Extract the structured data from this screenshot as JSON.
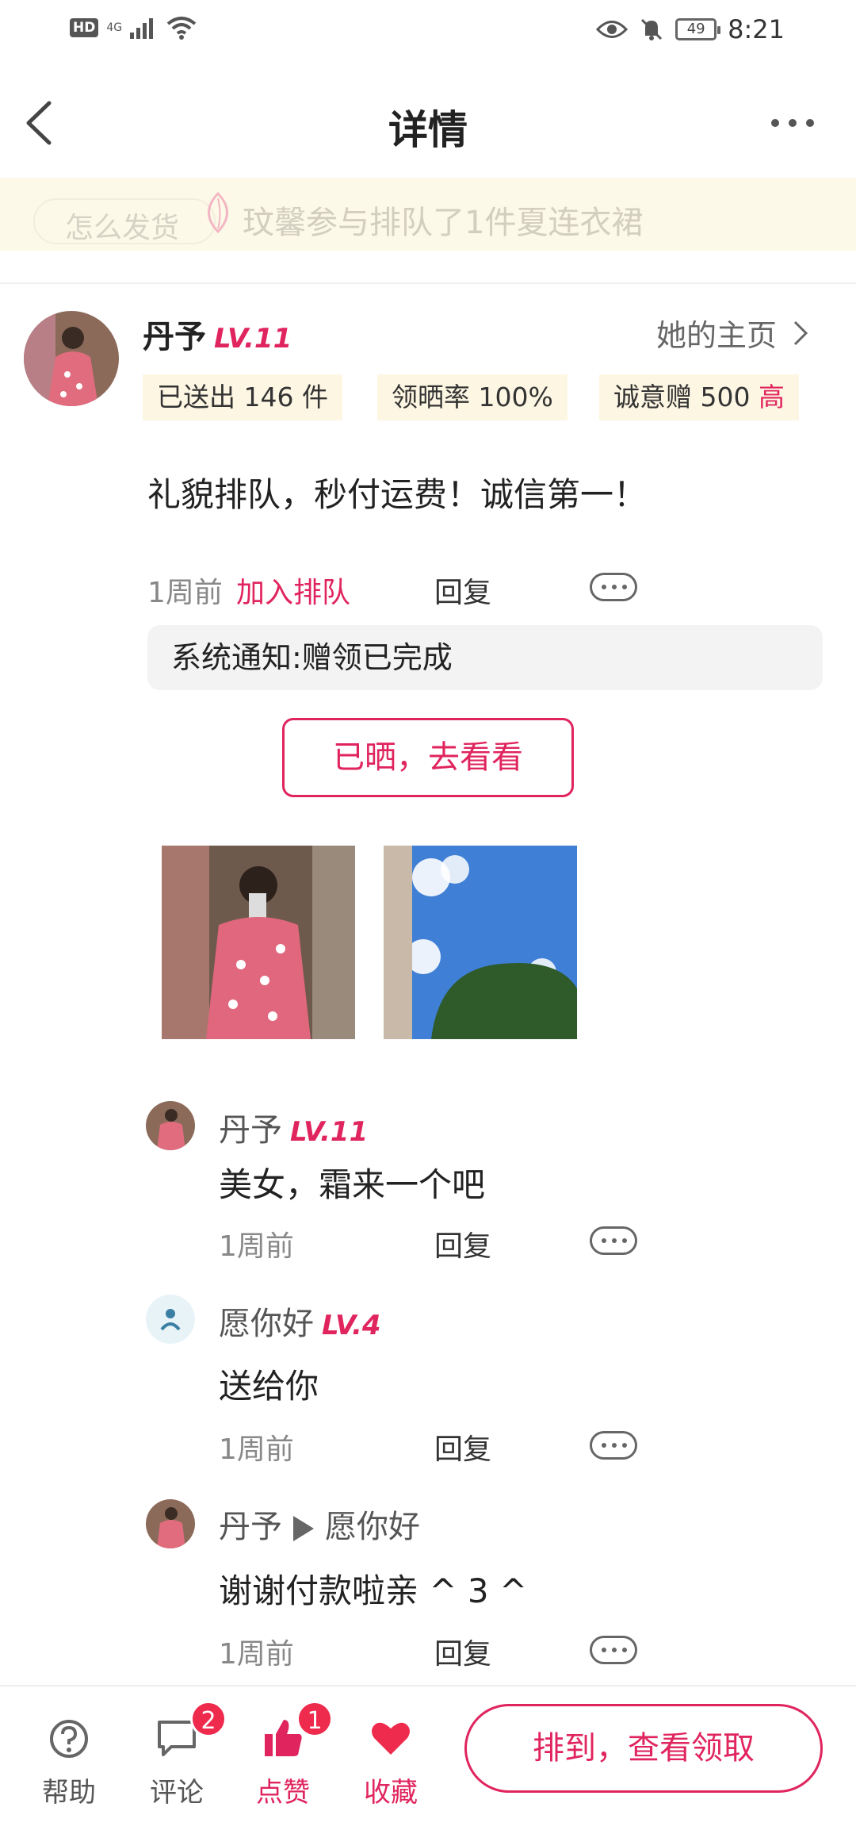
{
  "status_bar": {
    "hd": "HD",
    "network": "4G",
    "battery": "49",
    "time": "8:21"
  },
  "nav": {
    "title": "详情"
  },
  "banner": {
    "question": "怎么发货",
    "ticker": "玟馨参与排队了1件夏连衣裙"
  },
  "user": {
    "name": "丹予",
    "level": "LV.11",
    "homepage_label": "她的主页",
    "stats": {
      "sent": "已送出 146 件",
      "rate": "领晒率 100%",
      "sincerity": "诚意赠 500",
      "sincerity_tag": "高"
    }
  },
  "post": {
    "text": "礼貌排队，秒付运费！诚信第一！",
    "time": "1周前",
    "action": "加入排队",
    "reply": "回复",
    "system_notice": "系统通知:赠领已完成",
    "shown_button": "已晒，去看看"
  },
  "comments": [
    {
      "name": "丹予",
      "level": "LV.11",
      "text": "美女，霜来一个吧",
      "time": "1周前",
      "reply": "回复"
    },
    {
      "name": "愿你好",
      "level": "LV.4",
      "text": "送给你",
      "time": "1周前",
      "reply": "回复"
    },
    {
      "name": "丹予",
      "to": "愿你好",
      "text": "谢谢付款啦亲 ^ 3 ^",
      "time": "1周前",
      "reply": "回复"
    }
  ],
  "bottom": {
    "help": "帮助",
    "comment": "评论",
    "comment_badge": "2",
    "like": "点赞",
    "like_badge": "1",
    "favorite": "收藏",
    "claim_button": "排到，查看领取"
  },
  "colors": {
    "accent": "#e0245e",
    "banner_bg": "#fdf9e8",
    "stat_bg": "#fdf6e3"
  }
}
